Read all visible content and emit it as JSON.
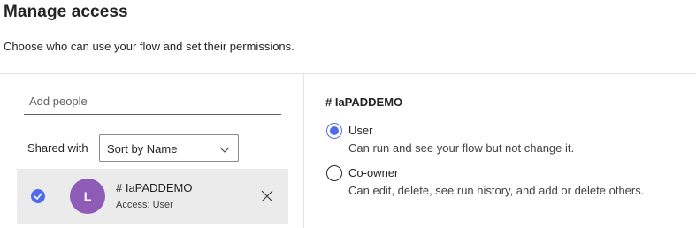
{
  "header": {
    "title": "Manage access",
    "subtitle": "Choose who can use your flow and set their permissions."
  },
  "people": {
    "add_placeholder": "Add people",
    "shared_with_label": "Shared with",
    "sort": {
      "selected": "Sort by Name",
      "icon": "chevron-down-icon"
    },
    "entries": [
      {
        "avatar_initial": "L",
        "name": "# IaPADDEMO",
        "access": "Access: User",
        "selected": true,
        "avatar_color": "#8e5bb7"
      }
    ]
  },
  "permissions": {
    "title": "# IaPADDEMO",
    "options": [
      {
        "label": "User",
        "description": "Can run and see your flow but not change it.",
        "checked": true
      },
      {
        "label": "Co-owner",
        "description": "Can edit, delete, see run history, and add or delete others.",
        "checked": false
      }
    ]
  },
  "colors": {
    "accent": "#4f6bed",
    "row_background": "#ebebeb",
    "divider": "#e3e3e3"
  }
}
